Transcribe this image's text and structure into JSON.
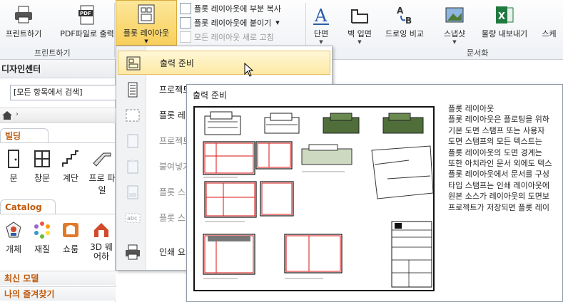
{
  "ribbon": {
    "print": "프린트하기",
    "print_pdf": "PDF파일로 출력",
    "plot_layout": "플롯 레이아웃",
    "copy_partial": "플롯 레이아웃에 부분 복사",
    "paste": "플롯 레이아웃에 붙이기",
    "refresh_all": "모든 레이아웃 새로 고침",
    "section": "단면",
    "wall_elevation": "벽 입면",
    "drawing_compare": "드로잉 비교",
    "snapshot": "스냅샷",
    "export_quantities": "물량 내보내기",
    "truncated": "스케",
    "group_print": "프린트하기",
    "group_docs": "문서화"
  },
  "left_panel": {
    "title": "디자인센터",
    "search": "[모든 항목에서 검색]",
    "building_tab": "빌딩",
    "building_items": [
      "문",
      "창문",
      "계단",
      "프로 파일"
    ],
    "catalog_tab": "Catalog",
    "catalog_items": [
      "개체",
      "재질",
      "쇼룸",
      "3D 웨어하"
    ],
    "recent": "최신 모델",
    "favorites": "나의 즐겨찾기"
  },
  "dropdown": {
    "items": [
      {
        "label": "출력 준비",
        "icon": "print-prepare-icon",
        "hover": true
      },
      {
        "label": "프로젝트",
        "icon": "project-stamp-icon"
      },
      {
        "label": "플롯 레",
        "icon": "plot-border-icon"
      },
      {
        "label": "프로젝트",
        "icon": "project-doc-icon"
      },
      {
        "label": "붙여넣기",
        "icon": "paste-icon"
      },
      {
        "label": "플롯 스",
        "icon": "plot-stamp-icon"
      },
      {
        "label": "플롯 스",
        "icon": "plot-text-icon"
      },
      {
        "label": "인쇄 요",
        "icon": "print-settings-icon"
      }
    ]
  },
  "tooltip": {
    "title": "출력 준비",
    "lines": [
      "플롯 레이아웃",
      "플롯 레이아웃은 플로팅을 위하",
      "기본 도면 스탬프 또는 사용자",
      "도면 스탬프의 모든 텍스트는",
      "플롯 레이아웃의 도면 경계는",
      "또한 아치라인 문서 외에도 텍스",
      "플롯 레이아웃에서 문서를 구성",
      "타입 스탬프는 인쇄 레이아웃에",
      "원본 소스가 레이아웃의 도면보",
      "프로젝트가 저장되면 플롯 레이"
    ]
  },
  "colors": {
    "accent_orange": "#c05a0c",
    "hover_yellow": "#fde9a5",
    "excel_green": "#1f7a3f"
  }
}
